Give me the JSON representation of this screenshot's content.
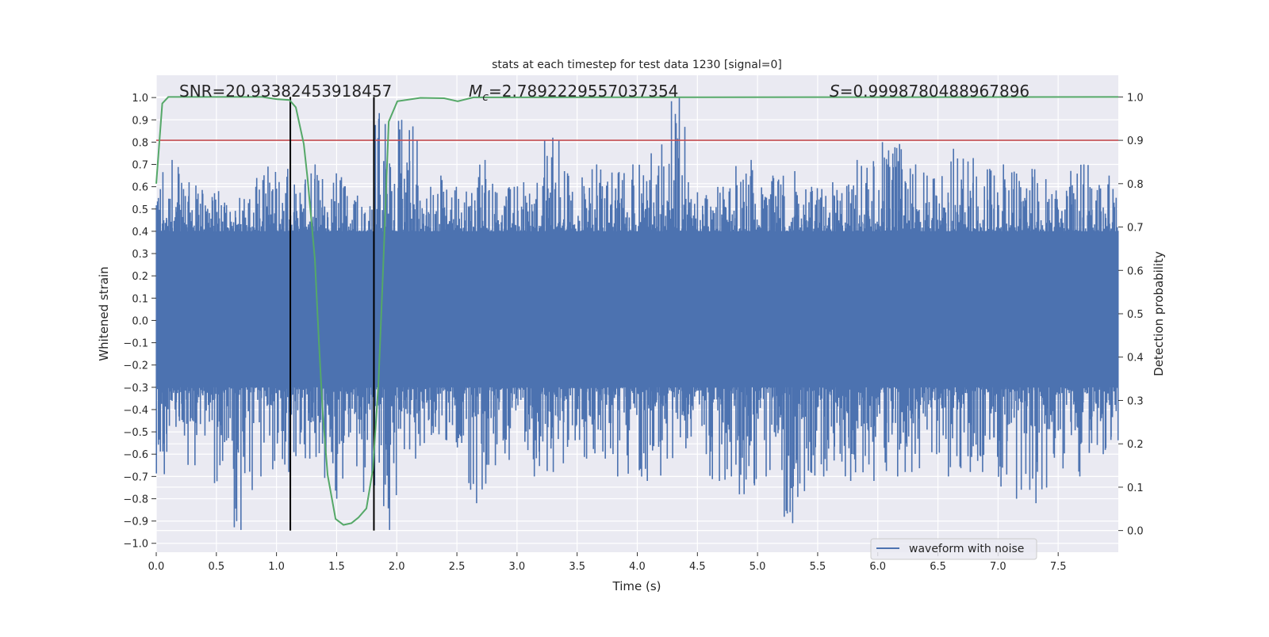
{
  "chart_data": {
    "type": "line",
    "title": "stats at each timestep for test data 1230 [signal=0]",
    "xlabel": "Time (s)",
    "ylabel_left": "Whitened strain",
    "ylabel_right": "Detection probability",
    "xlim": [
      0,
      8
    ],
    "ylim_left": [
      -1.04,
      1.1
    ],
    "ylim_right": [
      -0.05,
      1.05
    ],
    "x_ticks": [
      "0.0",
      "0.5",
      "1.0",
      "1.5",
      "2.0",
      "2.5",
      "3.0",
      "3.5",
      "4.0",
      "4.5",
      "5.0",
      "5.5",
      "6.0",
      "6.5",
      "7.0",
      "7.5"
    ],
    "left_ticks": [
      "−1.0",
      "−0.9",
      "−0.8",
      "−0.7",
      "−0.6",
      "−0.5",
      "−0.4",
      "−0.3",
      "−0.2",
      "−0.1",
      "0.0",
      "0.1",
      "0.2",
      "0.3",
      "0.4",
      "0.5",
      "0.6",
      "0.7",
      "0.8",
      "0.9",
      "1.0"
    ],
    "right_ticks": [
      "0.0",
      "0.1",
      "0.2",
      "0.3",
      "0.4",
      "0.5",
      "0.6",
      "0.7",
      "0.8",
      "0.9",
      "1.0"
    ],
    "grid": true,
    "legend": {
      "placement": "lower-right",
      "entries": [
        {
          "label": "waveform with noise",
          "color": "#4c72b0"
        }
      ]
    },
    "annotations": {
      "snr": "SNR=20.93382453918457",
      "mc_symbol": "M",
      "mc_sub": "c",
      "mc_value": "=2.7892229557037354",
      "s_symbol": "S",
      "s_value": "=0.9998780488967896"
    },
    "waveform": {
      "name": "waveform with noise",
      "color": "#4c72b0",
      "axis": "left",
      "core_band": [
        -0.3,
        0.4
      ],
      "bin_width_s": 0.2,
      "bin_max": [
        0.72,
        0.62,
        0.58,
        0.55,
        0.69,
        0.68,
        0.7,
        0.66,
        0.56,
        0.93,
        0.9,
        0.65,
        0.6,
        0.72,
        0.6,
        0.62,
        0.82,
        0.66,
        0.7,
        0.7,
        0.75,
        1.0,
        0.62,
        0.6,
        0.72,
        0.65,
        0.67,
        0.6,
        0.62,
        0.72,
        0.8,
        0.7,
        0.65,
        0.77,
        0.68,
        0.7,
        0.68,
        0.6,
        0.7,
        0.65
      ],
      "bin_min": [
        -0.69,
        -0.65,
        -0.73,
        -0.94,
        -0.7,
        -0.68,
        -0.62,
        -0.8,
        -0.77,
        -0.94,
        -0.62,
        -0.55,
        -0.57,
        -0.82,
        -0.65,
        -0.7,
        -0.68,
        -0.62,
        -0.62,
        -0.7,
        -0.72,
        -0.62,
        -0.6,
        -0.72,
        -0.78,
        -0.7,
        -0.91,
        -0.7,
        -0.72,
        -0.72,
        -0.7,
        -0.68,
        -0.7,
        -0.68,
        -0.68,
        -0.8,
        -0.82,
        -0.75,
        -0.7,
        -0.6
      ]
    },
    "detection_probability": {
      "color": "#55a868",
      "axis": "right",
      "x": [
        0.0,
        0.05,
        0.1,
        0.88,
        1.0,
        1.108,
        1.161,
        1.227,
        1.26,
        1.319,
        1.352,
        1.385,
        1.425,
        1.491,
        1.557,
        1.623,
        1.682,
        1.748,
        1.801,
        1.847,
        1.887,
        1.933,
        2.005,
        2.197,
        2.394,
        2.507,
        2.639,
        8.0
      ],
      "y": [
        0.8,
        0.985,
        1.0,
        1.0,
        0.995,
        0.993,
        0.976,
        0.892,
        0.808,
        0.626,
        0.438,
        0.269,
        0.128,
        0.027,
        0.013,
        0.017,
        0.03,
        0.051,
        0.141,
        0.337,
        0.606,
        0.943,
        0.99,
        0.998,
        0.997,
        0.99,
        0.999,
        1.0
      ]
    },
    "threshold": {
      "axis": "right",
      "value": 0.9,
      "color": "#c44e52"
    },
    "vertical_markers": {
      "axis": "right",
      "x": [
        1.115,
        1.81
      ],
      "y_range": [
        0,
        1
      ],
      "color": "#000000"
    }
  }
}
